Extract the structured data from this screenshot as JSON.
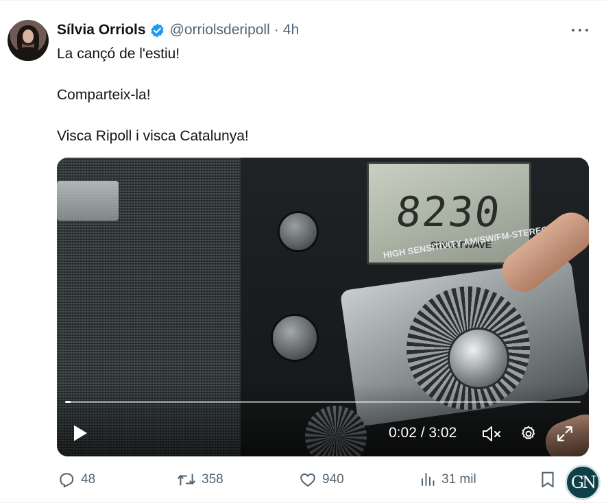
{
  "author": {
    "name": "Sílvia Orriols",
    "handle": "@orriolsderipoll",
    "separator": "·",
    "time": "4h",
    "verified": true,
    "avatar_icon": "avatar-photo"
  },
  "tweet": {
    "lines": [
      "La cançó de l'estiu!",
      "Comparteix-la!",
      "Visca Ripoll i visca Catalunya!"
    ]
  },
  "video": {
    "lcd_number": "8230",
    "lcd_label": "SHORTWAVE",
    "radio_label": "HIGH SENSITIVITY AM/SW/FM-STEREO RECEIVER",
    "time_readout": "0:02 / 3:02",
    "progress_fraction": 0.011,
    "controls": [
      "play-icon",
      "volume-muted-icon",
      "gear-icon",
      "expand-icon"
    ]
  },
  "actions": {
    "reply_count": "48",
    "retweet_count": "358",
    "like_count": "940",
    "views_count": "31 mil"
  },
  "watermark": {
    "text": "GN"
  },
  "colors": {
    "verified_blue": "#1d9bf0",
    "muted_text": "#536471",
    "primary_text": "#0f1419"
  }
}
